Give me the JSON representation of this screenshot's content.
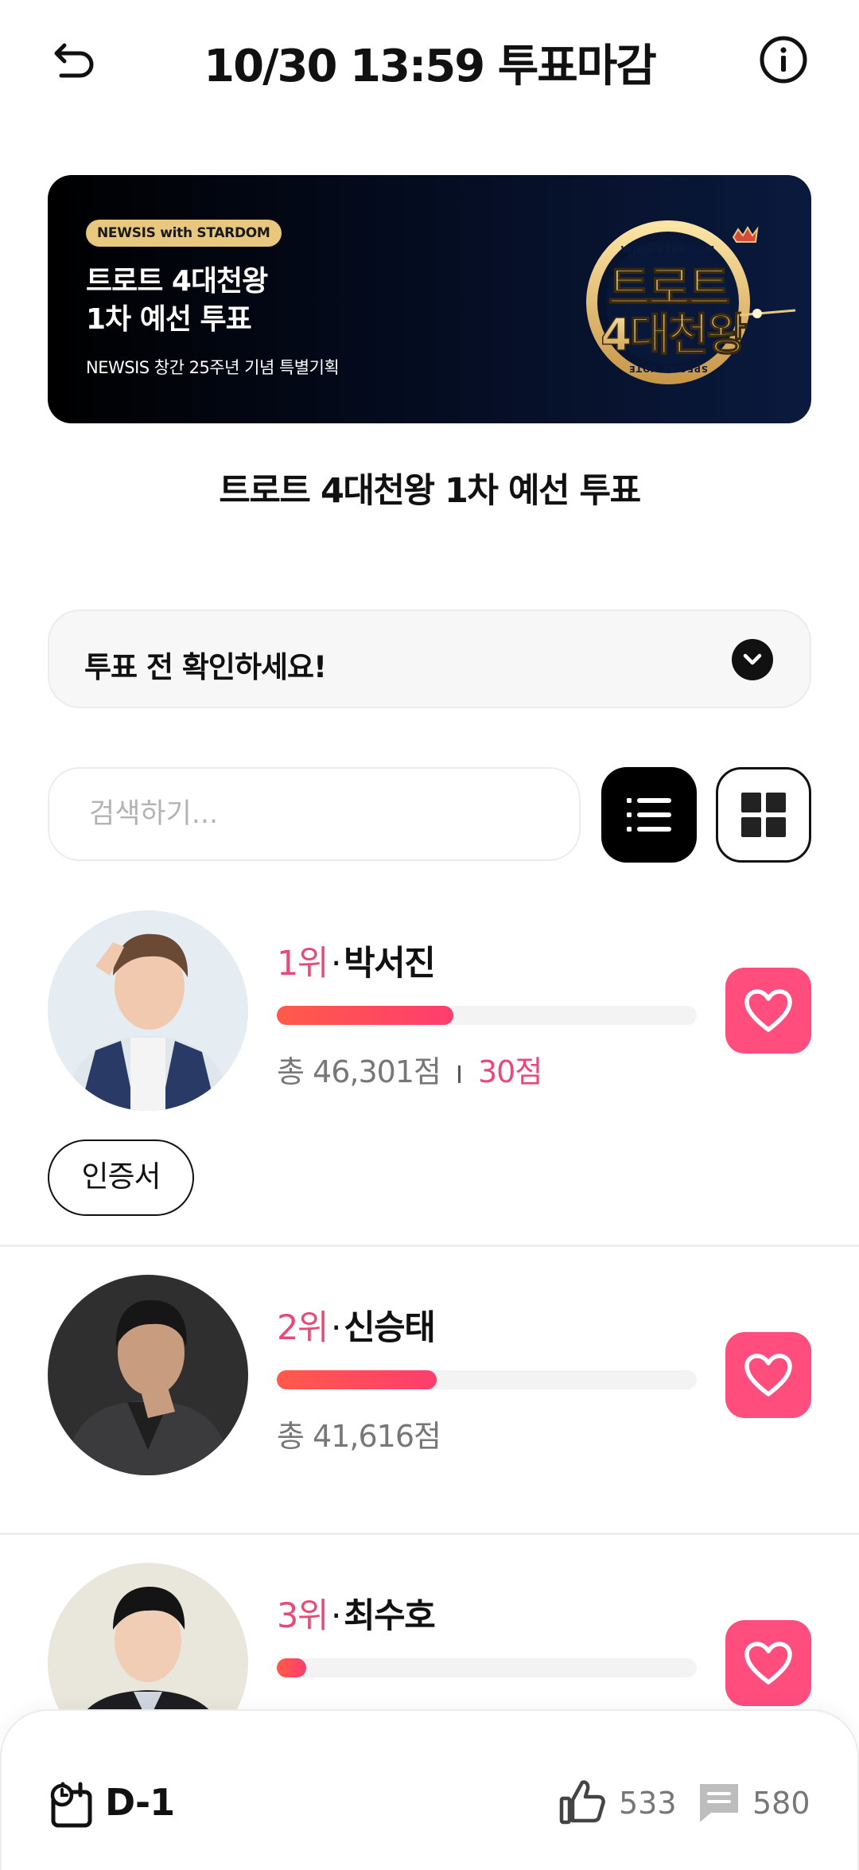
{
  "header": {
    "title": "10/30 13:59 투표마감",
    "back_icon": "undo-arrow-icon",
    "info_icon": "info-circle-icon"
  },
  "banner": {
    "tag": "NEWSIS with STARDOM",
    "title": "트로트 4대천왕\n1차 예선 투표",
    "subtitle": "NEWSIS 창간 25주년 기념 특별기획",
    "logo": {
      "ring_top": "WITH STARDOM",
      "line1": "트로트",
      "line2": "4대천왕",
      "ring_bottom": "SPECIAL VOTE"
    }
  },
  "poll": {
    "title": "트로트 4대천왕 1차 예선 투표"
  },
  "notice": {
    "label": "투표 전 확인하세요!"
  },
  "search": {
    "placeholder": "검색하기..."
  },
  "view_toggle": {
    "active": "list"
  },
  "candidates": [
    {
      "rank": "1위",
      "name": "박서진",
      "score": "총 46,301점",
      "plus_score": "30점",
      "progress": 0.42
    },
    {
      "rank": "2위",
      "name": "신승태",
      "score": "총 41,616점",
      "progress": 0.38
    },
    {
      "rank": "3위",
      "name": "최수호",
      "progress": 0.07
    }
  ],
  "certificate": {
    "label": "인증서"
  },
  "bottom": {
    "dday": "D-1",
    "likes": "533",
    "comments": "580"
  },
  "colors": {
    "accent_pink": "#ff4d7e",
    "rank_pink": "#e84a78",
    "bar_start": "#ff5a4a",
    "bar_end": "#ff3d6e",
    "banner_dark": "#040b1e",
    "banner_gold": "#e8c77e"
  }
}
